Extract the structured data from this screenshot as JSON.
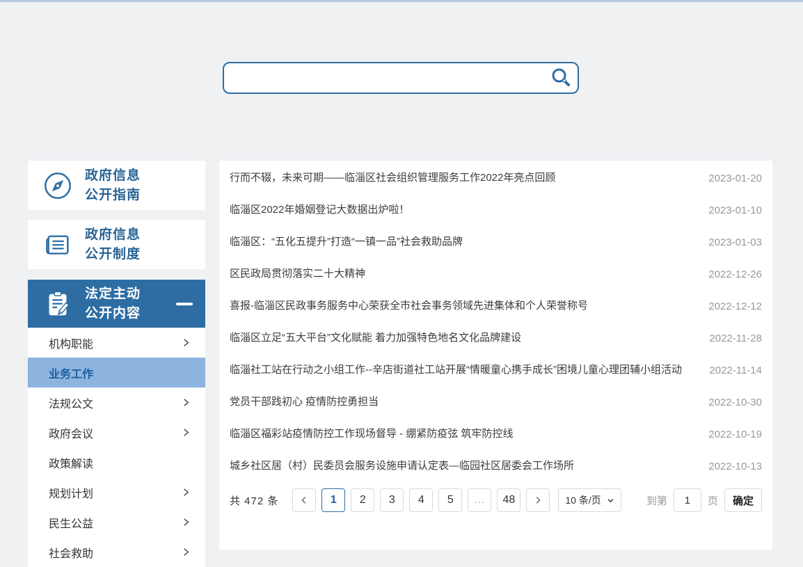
{
  "colors": {
    "accent_blue": "#2e6da4",
    "selected_item_bg": "#8db4de",
    "sidebar_text_blue": "#2a6496",
    "top_strip": "#b9c9e2",
    "page_background": "#f0f1f3",
    "date_gray": "#999999"
  },
  "search": {
    "value": "",
    "placeholder": "",
    "icon": "magnifier-icon"
  },
  "sidebar": {
    "guide": {
      "line1": "政府信息",
      "line2": "公开指南",
      "icon": "compass-icon"
    },
    "system": {
      "line1": "政府信息",
      "line2": "公开制度",
      "icon": "document-icon"
    },
    "statutory": {
      "line1": "法定主动",
      "line2": "公开内容",
      "icon": "clipboard-pencil-icon",
      "collapse_icon": "minus-icon"
    },
    "items": [
      {
        "label": "机构职能"
      },
      {
        "label": "业务工作"
      },
      {
        "label": "法规公文"
      },
      {
        "label": "政府会议"
      },
      {
        "label": "政策解读"
      },
      {
        "label": "规划计划"
      },
      {
        "label": "民生公益"
      },
      {
        "label": "社会救助"
      }
    ]
  },
  "articles": [
    {
      "title": "行而不辍，未来可期——临淄区社会组织管理服务工作2022年亮点回顾",
      "date": "2023-01-20"
    },
    {
      "title": "临淄区2022年婚姻登记大数据出炉啦！",
      "date": "2023-01-10"
    },
    {
      "title": "临淄区：“五化五提升”打造“一镇一品”社会救助品牌",
      "date": "2023-01-03"
    },
    {
      "title": "区民政局贯彻落实二十大精神",
      "date": "2022-12-26"
    },
    {
      "title": "喜报-临淄区民政事务服务中心荣获全市社会事务领域先进集体和个人荣誉称号",
      "date": "2022-12-12"
    },
    {
      "title": "临淄区立足“五大平台”文化赋能 着力加强特色地名文化品牌建设",
      "date": "2022-11-28"
    },
    {
      "title": "临淄社工站在行动之小组工作--辛店街道社工站开展“情暖童心携手成长”困境儿童心理团辅小组活动",
      "date": "2022-11-14"
    },
    {
      "title": "党员干部践初心 疫情防控勇担当",
      "date": "2022-10-30"
    },
    {
      "title": "临淄区福彩站疫情防控工作现场督导 - 绷紧防疫弦 筑牢防控线",
      "date": "2022-10-19"
    },
    {
      "title": "城乡社区居（村）民委员会服务设施申请认定表—临园社区居委会工作场所",
      "date": "2022-10-13"
    }
  ],
  "pagination": {
    "total_text": "共 472 条",
    "pages": [
      "1",
      "2",
      "3",
      "4",
      "5",
      "…",
      "48"
    ],
    "active_page": "1",
    "page_size": "10 条/页",
    "goto_label": "到第",
    "goto_value": "1",
    "goto_unit": "页",
    "confirm_label": "确定"
  }
}
